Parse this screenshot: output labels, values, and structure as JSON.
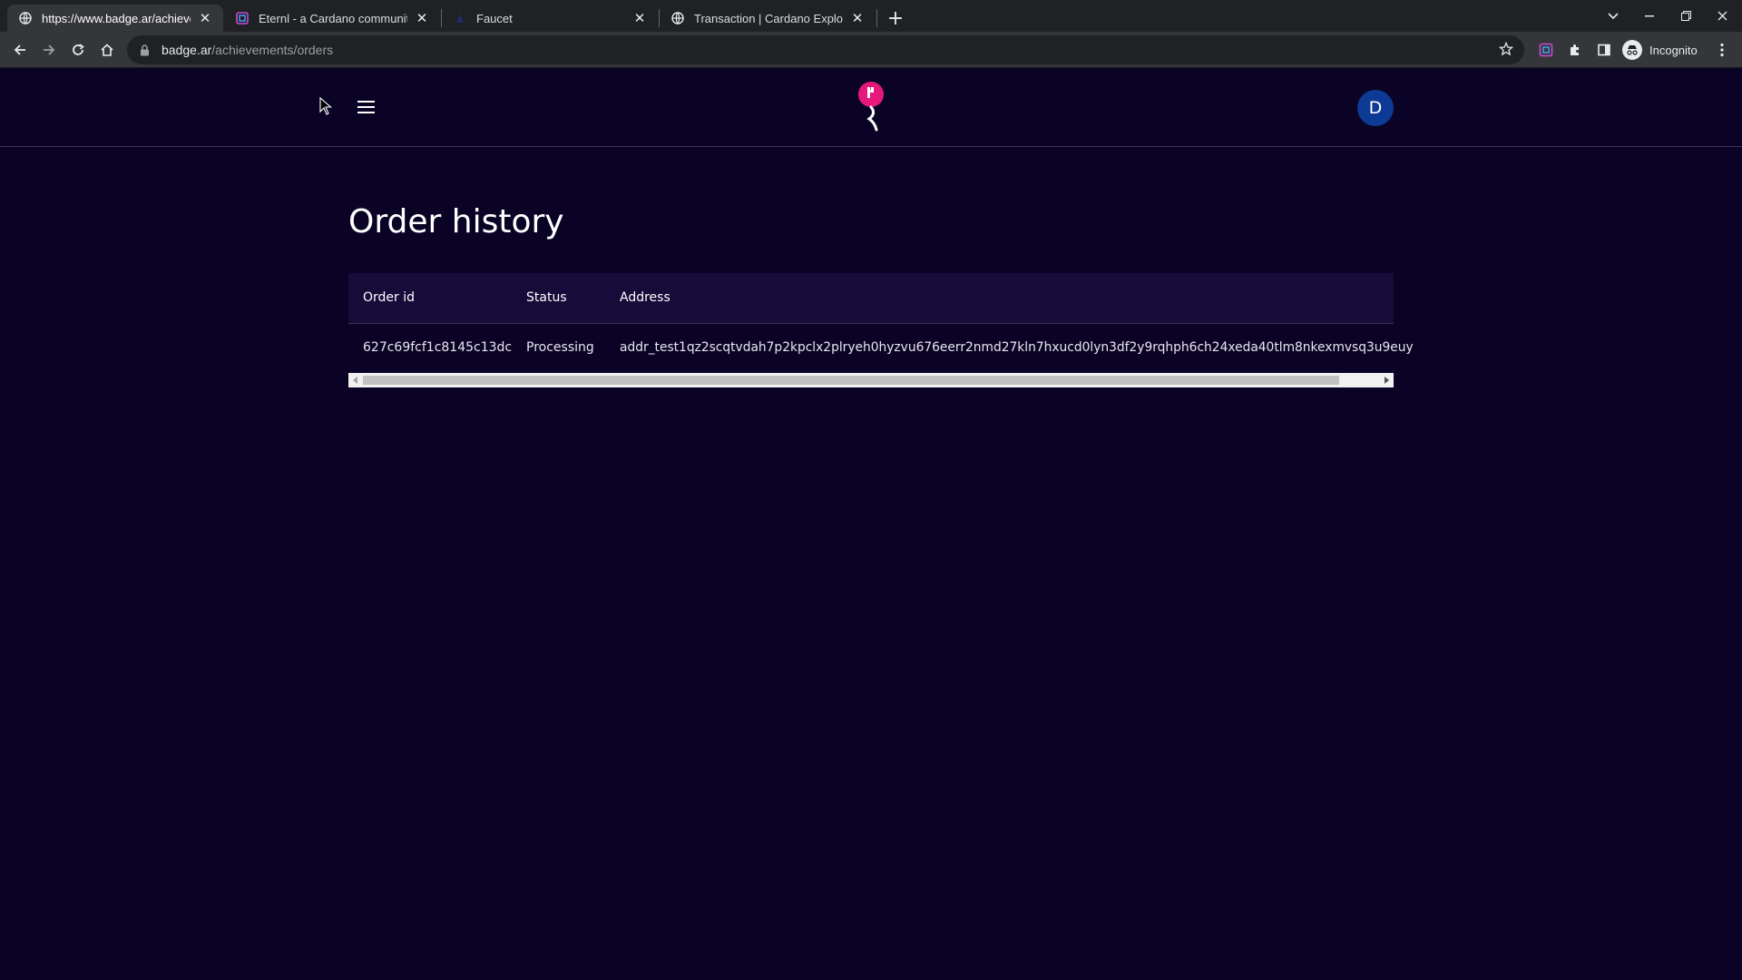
{
  "browser": {
    "tabs": [
      {
        "title": "https://www.badge.ar/achievem",
        "active": true,
        "icon": "globe-icon"
      },
      {
        "title": "Eternl - a Cardano community w",
        "active": false,
        "icon": "eternl-icon"
      },
      {
        "title": "Faucet",
        "active": false,
        "icon": "faucet-icon"
      },
      {
        "title": "Transaction | Cardano Explorer",
        "active": false,
        "icon": "globe-icon"
      }
    ],
    "url_host": "badge.ar",
    "url_path": "/achievements/orders",
    "incognito_label": "Incognito"
  },
  "header": {
    "avatar_initial": "D",
    "logo_color": "#e6197a",
    "avatar_color": "#0d3a94"
  },
  "main": {
    "title": "Order history",
    "table": {
      "columns": [
        "Order id",
        "Status",
        "Address"
      ],
      "rows": [
        {
          "order_id": "627c69fcf1c8145c13dc",
          "status": "Processing",
          "address": "addr_test1qz2scqtvdah7p2kpclx2plryeh0hyzvu676eerr2nmd27kln7hxucd0lyn3df2y9rqhph6ch24xeda40tlm8nkexmvsq3u9euy"
        }
      ]
    }
  },
  "colors": {
    "page_bg": "#0b0326",
    "table_header_bg": "#170b3a"
  }
}
